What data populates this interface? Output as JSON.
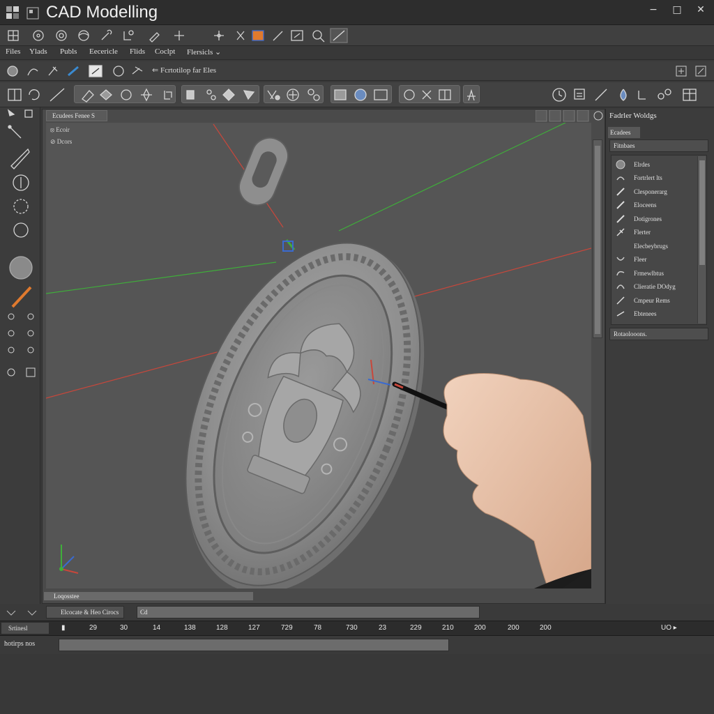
{
  "app": {
    "title": "CAD Modelling"
  },
  "window_controls": {
    "minimize": "−",
    "maximize": "□",
    "close": "✕"
  },
  "menu": [
    {
      "label": "Files"
    },
    {
      "label": "Ylads"
    },
    {
      "label": "Publs"
    },
    {
      "label": "Eecericle"
    },
    {
      "label": "Flids"
    },
    {
      "label": "Coclpt"
    },
    {
      "label": "Flersicls ⌄"
    }
  ],
  "toolbar2": {
    "label": "⇐ Fcrtotilop far Eles"
  },
  "viewport": {
    "tab": "Ecudees Fenee S",
    "overlay1": "⦻ Ecoir",
    "overlay2": "⊘ Dcors",
    "status": "Loqosstee"
  },
  "right_panel": {
    "title": "Fadrler Woldgs",
    "tab": "Ecadees",
    "select": "Fitnbaes",
    "items": [
      {
        "label": "Elrdes",
        "icon": "circle-icon"
      },
      {
        "label": "Fortrlert lts",
        "icon": "shape-icon"
      },
      {
        "label": "Clesponerarg",
        "icon": "pen-icon"
      },
      {
        "label": "Eloceens",
        "icon": "pen-icon"
      },
      {
        "label": "Dotigrones",
        "icon": "pen-icon"
      },
      {
        "label": "Flerter",
        "icon": "pencil-icon"
      },
      {
        "label": "Elecbeybrugs",
        "icon": "none"
      },
      {
        "label": "Fleer",
        "icon": "curve-icon"
      },
      {
        "label": "Frmewlbtus",
        "icon": "curve-icon"
      },
      {
        "label": "Clieratie DOdyg",
        "icon": "curve-icon"
      },
      {
        "label": "Cmpeur Rems",
        "icon": "pen-icon"
      },
      {
        "label": "Ebtenees",
        "icon": "pen-icon"
      }
    ],
    "footer": "Rotaolooons."
  },
  "command": {
    "label": "Elcocate & Heo Cirocs",
    "input": "Cd"
  },
  "timeline": {
    "label": "Srtinesl",
    "ticks": [
      "29",
      "30",
      "14",
      "138",
      "128",
      "127",
      "729",
      "78",
      "730",
      "23",
      "229",
      "210",
      "200",
      "200",
      "200"
    ],
    "end": "UO ▸"
  },
  "properties": {
    "label": "hotirps nos"
  },
  "colors": {
    "axis_red": "#c8473b",
    "axis_green": "#3fae3a",
    "axis_blue": "#3a6ad0",
    "accent_orange": "#e07a2e"
  }
}
